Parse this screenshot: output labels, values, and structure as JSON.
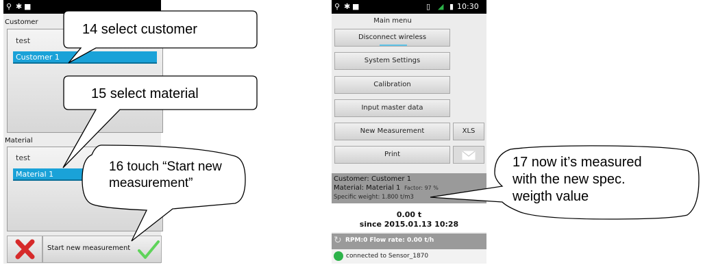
{
  "left_phone": {
    "customer_label": "Customer",
    "customer_list": [
      "test",
      "Customer 1"
    ],
    "material_label": "Material",
    "material_list": [
      "test",
      "Material 1"
    ],
    "start_button_label": "Start new measurement"
  },
  "right_phone": {
    "status_time": "10:30",
    "title": "Main menu",
    "menu": {
      "disconnect": "Disconnect wireless",
      "system_settings": "System Settings",
      "calibration": "Calibration",
      "input_master_data": "Input master data",
      "new_measurement": "New Measurement",
      "xls": "XLS",
      "print": "Print"
    },
    "info": {
      "customer": "Customer: Customer 1",
      "material": "Material: Material 1",
      "factor": "Factor: 97 %",
      "specific_weight": "Specific weight:  1.800 t/m3"
    },
    "total": {
      "amount": "0.00 t",
      "since": "since 2015.01.13 10:28"
    },
    "rpm_line": "RPM:0  Flow rate:  0.00  t/h",
    "connection": "connected to Sensor_1870"
  },
  "callouts": {
    "c14": "14 select customer",
    "c15": "15 select material",
    "c16_line1": "16 touch “Start new",
    "c16_line2": "measurement”",
    "c17_line1": "17 now it’s measured",
    "c17_line2": "with the new spec.",
    "c17_line3": "weigth value"
  },
  "colors": {
    "selection_blue": "#1aa2d8",
    "connected_green": "#2db34a",
    "check_green": "#5fd35a",
    "cross_red": "#d62a2a"
  },
  "icons": [
    "usb-icon",
    "bluetooth-icon",
    "battery-icon",
    "signal-icon",
    "envelope-icon",
    "refresh-icon",
    "close-icon",
    "checkmark-icon"
  ]
}
